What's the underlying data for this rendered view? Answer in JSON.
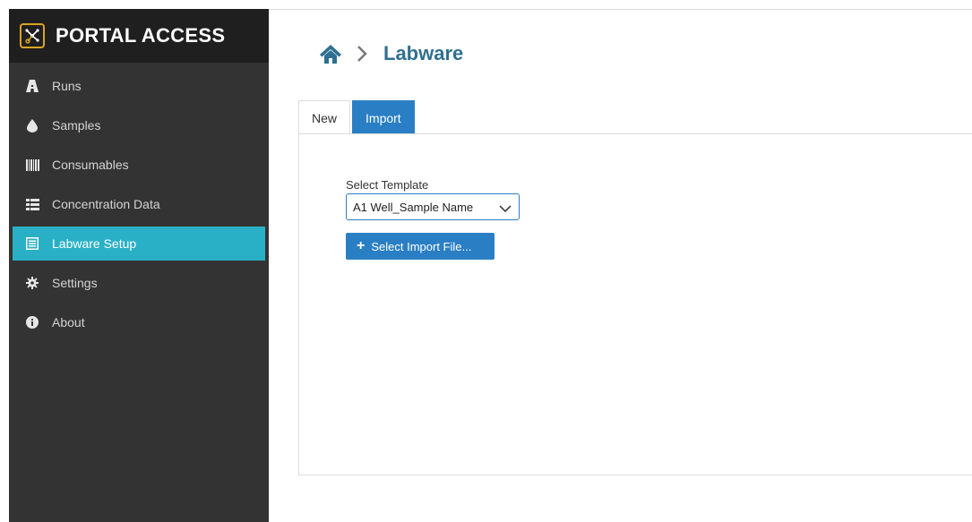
{
  "app": {
    "title": "PORTAL ACCESS"
  },
  "sidebar": {
    "items": [
      {
        "label": "Runs",
        "icon": "road-icon"
      },
      {
        "label": "Samples",
        "icon": "drop-icon"
      },
      {
        "label": "Consumables",
        "icon": "barcode-icon"
      },
      {
        "label": "Concentration Data",
        "icon": "list-icon"
      },
      {
        "label": "Labware Setup",
        "icon": "list-alt-icon",
        "active": true
      },
      {
        "label": "Settings",
        "icon": "gear-icon"
      },
      {
        "label": "About",
        "icon": "info-icon"
      }
    ]
  },
  "breadcrumb": {
    "title": "Labware"
  },
  "tabs": [
    {
      "label": "New"
    },
    {
      "label": "Import",
      "active": true
    }
  ],
  "import_form": {
    "template_label": "Select Template",
    "template_value": "A1 Well_Sample Name",
    "button_icon": "+",
    "button_label": "Select Import File..."
  },
  "colors": {
    "sidebar_bg": "#333333",
    "brand_bg": "#1f1f1f",
    "active_nav": "#2ab0c6",
    "primary": "#2a7fc4",
    "title": "#2f6f90",
    "logo_accent": "#d9a520"
  }
}
